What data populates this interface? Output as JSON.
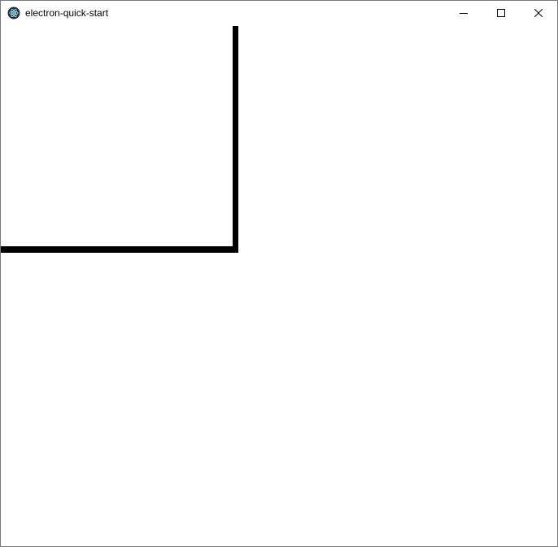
{
  "window": {
    "title": "electron-quick-start",
    "app_icon": "electron-atom-icon",
    "controls": {
      "minimize_icon": "minimize-icon",
      "maximize_icon": "maximize-icon",
      "close_icon": "close-icon"
    }
  },
  "colors": {
    "stroke": "#000000",
    "background": "#ffffff",
    "border": "#7a7a7a"
  }
}
